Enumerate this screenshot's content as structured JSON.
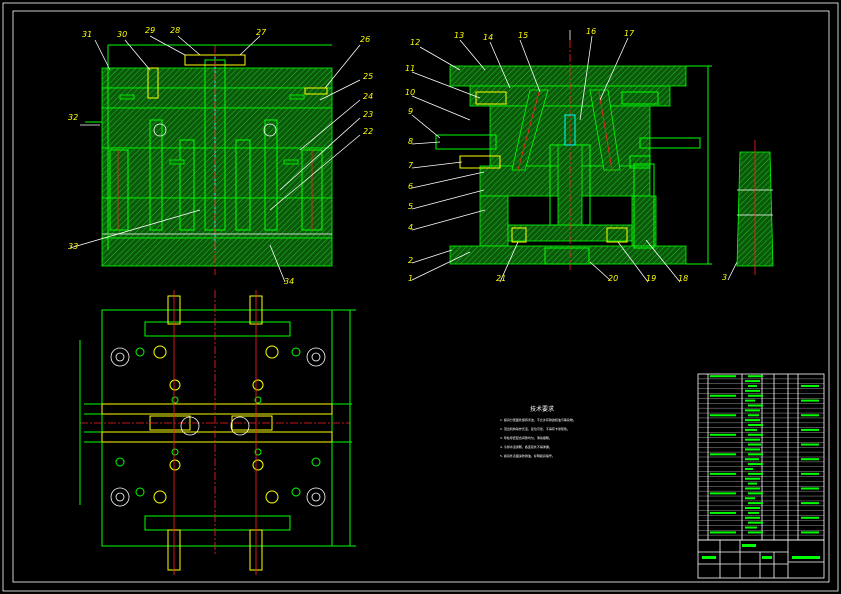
{
  "drawing": {
    "colors": {
      "background": "#000000",
      "frame": "#ffffff",
      "part": "#00ff00",
      "label": "#ffff00",
      "center_line": "#ff2020",
      "highlight": "#00ffff"
    },
    "front_section_labels": [
      "31",
      "30",
      "29",
      "28",
      "27",
      "26",
      "25",
      "24",
      "23",
      "22",
      "32",
      "33",
      "34"
    ],
    "side_section_labels": [
      "12",
      "13",
      "14",
      "15",
      "16",
      "17",
      "11",
      "10",
      "9",
      "8",
      "7",
      "6",
      "5",
      "4",
      "2",
      "1",
      "21",
      "20",
      "19",
      "18",
      "3"
    ],
    "technical_requirements_title": "技术要求",
    "technical_requirements_lines": [
      "1. 模具分型面处保持清洁，不允许有锈迹和油污等杂物。",
      "2. 顶出机构动作灵活，复位可靠，不得有卡滞现象。",
      "3. 导柱导套配合间隙均匀，滑动顺畅。",
      "4. 冷却水道通畅，各连接处不得渗漏。",
      "5. 模具外表面涂防锈油，标明模具编号。"
    ]
  }
}
